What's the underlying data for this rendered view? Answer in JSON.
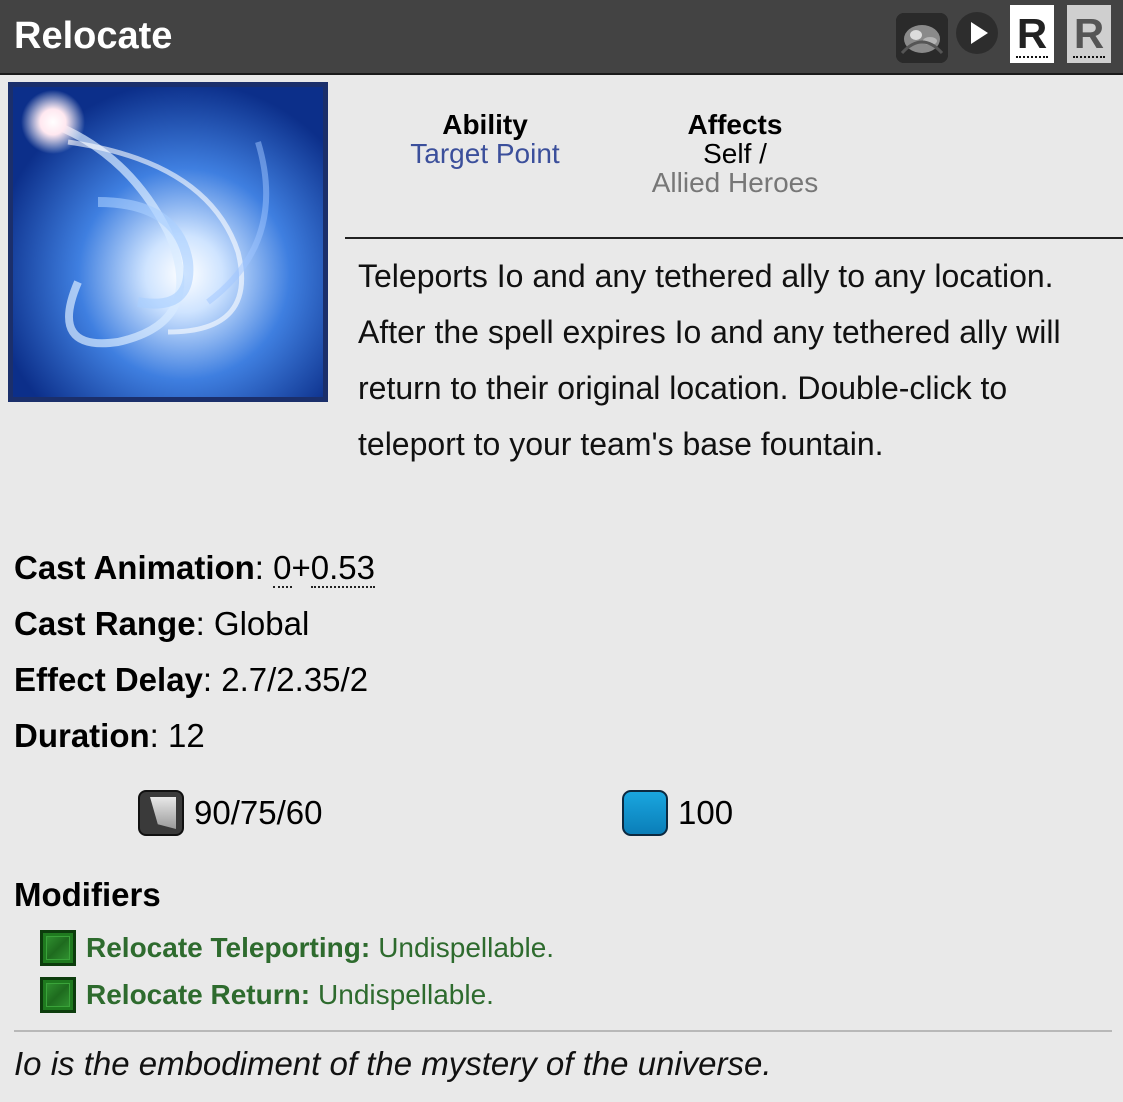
{
  "header": {
    "title": "Relocate",
    "icons": [
      "io-hero-portrait-icon",
      "play-icon"
    ],
    "hotkeys": [
      "R",
      "R"
    ]
  },
  "ability_image": "relocate-spell-icon",
  "meta": {
    "ability_label": "Ability",
    "ability_value": "Target Point",
    "affects_label": "Affects",
    "affects_value_1": "Self /",
    "affects_value_2": "Allied Heroes"
  },
  "description": "Teleports Io and any tethered ally to any location. After the spell expires Io and any tethered ally will return to their original location. Double-click to teleport to your team's base fountain.",
  "stats": {
    "cast_animation_label": "Cast Animation",
    "cast_animation_a": "0",
    "cast_animation_plus": "+",
    "cast_animation_b": "0.53",
    "cast_range_label": "Cast Range",
    "cast_range_value": "Global",
    "effect_delay_label": "Effect Delay",
    "effect_delay_value": "2.7/2.35/2",
    "duration_label": "Duration",
    "duration_value": "12"
  },
  "costs": {
    "cooldown": "90/75/60",
    "mana": "100"
  },
  "modifiers": {
    "heading": "Modifiers",
    "items": [
      {
        "name": "Relocate Teleporting:",
        "value": "Undispellable."
      },
      {
        "name": "Relocate Return:",
        "value": "Undispellable."
      }
    ]
  },
  "lore": "Io is the embodiment of the mystery of the universe.",
  "colors": {
    "header_bg": "#434343",
    "link_blue": "#3b4f9b",
    "modifier_green": "#2e6b2e",
    "mana_blue": "#1aa6df"
  }
}
